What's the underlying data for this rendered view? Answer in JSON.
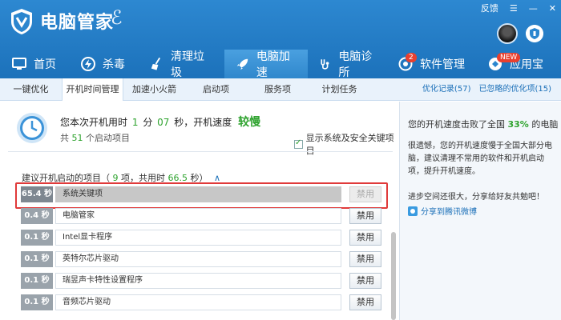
{
  "app": {
    "title": "电脑管家"
  },
  "window_controls": {
    "feedback": "反馈",
    "menu": "☰",
    "minimize": "—",
    "close": "✕"
  },
  "nav": [
    {
      "label": "首页",
      "icon": "monitor-icon"
    },
    {
      "label": "杀毒",
      "icon": "lightning-icon"
    },
    {
      "label": "清理垃圾",
      "icon": "broom-icon"
    },
    {
      "label": "电脑加速",
      "icon": "rocket-icon",
      "active": true
    },
    {
      "label": "电脑诊所",
      "icon": "stethoscope-icon"
    },
    {
      "label": "软件管理",
      "icon": "software-icon",
      "badge": "2"
    },
    {
      "label": "应用宝",
      "icon": "app-store-icon",
      "badge": "NEW"
    }
  ],
  "subtabs": [
    "一键优化",
    "开机时间管理",
    "加速小火箭",
    "启动项",
    "服务项",
    "计划任务"
  ],
  "subtab_active": "开机时间管理",
  "sublinks": {
    "optimized": "优化记录(57)",
    "ignored": "已忽略的优化项(15)"
  },
  "summary": {
    "line1_prefix": "您本次开机用时",
    "minutes": "1",
    "min_unit": "分",
    "seconds": "07",
    "sec_unit": "秒，开机速度",
    "speed": "较慢",
    "line2_prefix": "共",
    "count": "51",
    "line2_suffix": "个启动项目",
    "checkbox_label": "显示系统及安全关键项目"
  },
  "section": {
    "prefix": "建议开机启动的项目（",
    "count": "9",
    "mid": "项，共用时",
    "time": "66.5",
    "suffix": "秒）",
    "caret": "∧"
  },
  "items": [
    {
      "time": "65.4 秒",
      "name": "系统关键项",
      "button": "禁用",
      "selected": true
    },
    {
      "time": "0.4 秒",
      "name": "电脑管家",
      "button": "禁用"
    },
    {
      "time": "0.1 秒",
      "name": "Intel显卡程序",
      "button": "禁用"
    },
    {
      "time": "0.1 秒",
      "name": "英特尔芯片驱动",
      "button": "禁用"
    },
    {
      "time": "0.1 秒",
      "name": "瑞昱声卡特性设置程序",
      "button": "禁用"
    },
    {
      "time": "0.1 秒",
      "name": "音频芯片驱动",
      "button": "禁用"
    }
  ],
  "right": {
    "title_prefix": "您的开机速度击败了全国",
    "percent": "33%",
    "title_suffix": "的电脑",
    "desc": "很遗憾，您的开机速度慢于全国大部分电脑，建议清理不常用的软件和开机启动项，提升开机速度。",
    "share": "进步空间还很大，分享给好友共勉吧！",
    "weibo": "分享到腾讯微博"
  },
  "colors": {
    "brand": "#1a6fb8",
    "good": "#2fa32f",
    "alert": "#e03a3a"
  }
}
